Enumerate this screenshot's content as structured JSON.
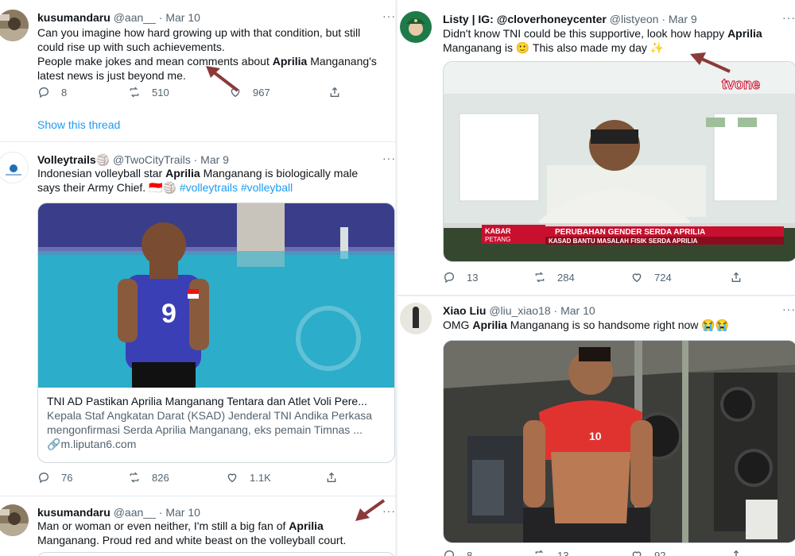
{
  "colors": {
    "link": "#1d9bf0",
    "secondary_text": "#536471",
    "primary_text": "#0f1419",
    "arrow": "#8b3a3a",
    "tvone_red": "#c8102e"
  },
  "left_column": {
    "tweet1": {
      "name": "kusumandaru",
      "handle": "@aan__",
      "date": "Mar 10",
      "more": "···",
      "text_line1": "Can you imagine how hard growing up with that condition, but still",
      "text_line2": "could rise up with such achievements.",
      "text_line3a": "People make jokes and mean comments about ",
      "text_line3b": "Aprilia",
      "text_line3c": " Manganang's",
      "text_line4": "latest news is just beyond me.",
      "replies": "8",
      "retweets": "510",
      "likes": "967",
      "show_thread": "Show this thread"
    },
    "tweet2": {
      "name": "Volleytrails",
      "name_badge": "🏐",
      "handle": "@TwoCityTrails",
      "date": "Mar 9",
      "more": "···",
      "text_line1a": "Indonesian volleyball star ",
      "text_line1b": "Aprilia",
      "text_line1c": " Manganang is biologically male",
      "text_line2a": "says their Army Chief. ",
      "text_line2_flag": "🇮🇩🏐",
      "hashtag1": "#volleytrails",
      "hashtag2": "#volleyball",
      "card_title": "TNI AD Pastikan Aprilia Manganang Tentara dan Atlet Voli Pere...",
      "card_desc_line1": "Kepala Staf Angkatan Darat (KSAD) Jenderal TNI Andika Perkasa",
      "card_desc_line2": "mengonfirmasi Serda Aprilia Manganang, eks pemain Timnas ...",
      "card_domain": "m.liputan6.com",
      "jersey_number": "9",
      "replies": "76",
      "retweets": "826",
      "likes": "1.1K"
    },
    "tweet3": {
      "name": "kusumandaru",
      "handle": "@aan__",
      "date": "Mar 10",
      "more": "···",
      "text_line1a": "Man or woman or even neither, I'm still a big fan of ",
      "text_line1b": "Aprilia",
      "text_line2": "Manganang. Proud red and white beast on the volleyball court."
    }
  },
  "right_column": {
    "tweet1": {
      "name": "Listy | IG: @cloverhoneycenter",
      "handle": "@listyeon",
      "date": "Mar 9",
      "more": "···",
      "text_line1a": "Didn't know TNI could be this supportive, look how happy ",
      "text_line1b": "Aprilia",
      "text_line2a": "Manganang is ",
      "emoji1": "🙂",
      "text_line2b": " This also made my day ",
      "emoji2": "✨",
      "tv_logo": "tvone",
      "banner_brand1": "KABAR",
      "banner_brand2": "PETANG",
      "banner_headline": "PERUBAHAN GENDER SERDA APRILIA",
      "banner_subheadline": "KASAD BANTU MASALAH FISIK SERDA APRILIA",
      "replies": "13",
      "retweets": "284",
      "likes": "724"
    },
    "tweet2": {
      "name": "Xiao Liu",
      "handle": "@liu_xiao18",
      "date": "Mar 10",
      "more": "···",
      "text_line1a": "OMG ",
      "text_line1b": "Aprilia",
      "text_line1c": " Manganang is so handsome right now ",
      "emoji": "😭😭",
      "shirt_text": "10",
      "replies": "8",
      "retweets": "13",
      "likes": "92"
    }
  }
}
